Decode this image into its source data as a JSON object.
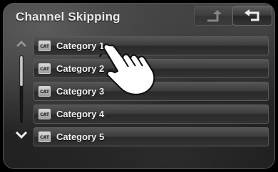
{
  "header": {
    "title": "Channel Skipping"
  },
  "toolbar": {
    "up_icon": "up-level-arrow-icon",
    "back_icon": "return-arrow-icon"
  },
  "scrollbar": {
    "up_icon": "chevron-up-icon",
    "down_icon": "chevron-down-icon",
    "position_fraction": 0.0,
    "visible_fraction": 0.45
  },
  "list": {
    "items": [
      {
        "icon_text": "CAT",
        "label": "Category 1"
      },
      {
        "icon_text": "CAT",
        "label": "Category 2"
      },
      {
        "icon_text": "CAT",
        "label": "Category 3"
      },
      {
        "icon_text": "CAT",
        "label": "Category 4"
      },
      {
        "icon_text": "CAT",
        "label": "Category 5"
      }
    ]
  },
  "overlay": {
    "icon": "pointing-hand-icon"
  },
  "colors": {
    "text": "#f2f2f2",
    "background": "#242424"
  }
}
